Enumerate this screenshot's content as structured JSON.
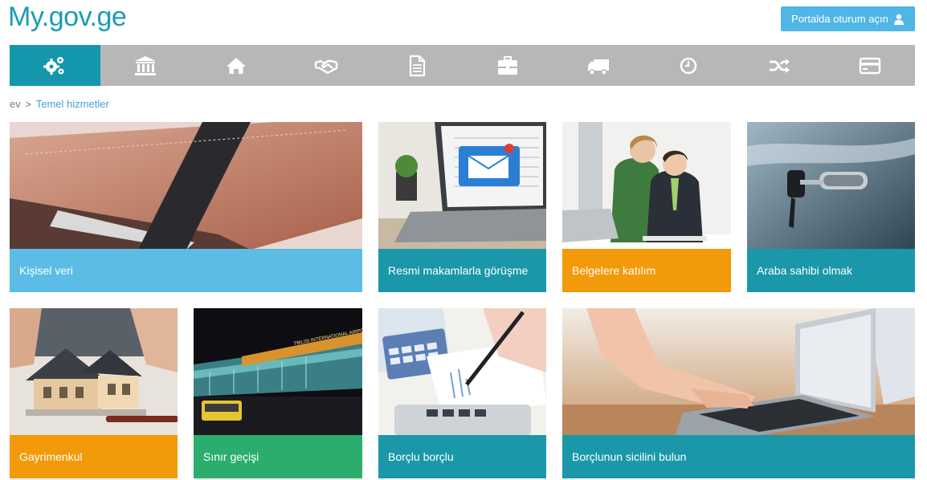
{
  "header": {
    "logo": "My.gov.ge",
    "login_label": "Portalda oturum açın"
  },
  "nav": {
    "items": [
      {
        "icon": "gears-icon",
        "active": true
      },
      {
        "icon": "institution-icon",
        "active": false
      },
      {
        "icon": "home-icon",
        "active": false
      },
      {
        "icon": "handshake-icon",
        "active": false
      },
      {
        "icon": "document-icon",
        "active": false
      },
      {
        "icon": "briefcase-icon",
        "active": false
      },
      {
        "icon": "truck-icon",
        "active": false
      },
      {
        "icon": "clock-icon",
        "active": false
      },
      {
        "icon": "shuffle-icon",
        "active": false
      },
      {
        "icon": "credit-card-icon",
        "active": false
      }
    ]
  },
  "breadcrumb": {
    "home": "ev",
    "separator": ">",
    "current": "Temel hizmetler"
  },
  "tiles": [
    {
      "label": "Kişisel veri",
      "color": "#5bbde6"
    },
    {
      "label": "Resmi makamlarla görüşme",
      "color": "#1a98a9"
    },
    {
      "label": "Belgelere katılım",
      "color": "#f29a0a"
    },
    {
      "label": "Araba sahibi olmak",
      "color": "#1a98a9"
    },
    {
      "label": "Gayrimenkul",
      "color": "#f29a0a"
    },
    {
      "label": "Sınır geçişi",
      "color": "#2bae6d"
    },
    {
      "label": "Borçlu borçlu",
      "color": "#1a98a9"
    },
    {
      "label": "Borçlunun sicilini bulun",
      "color": "#1a98a9"
    }
  ],
  "photo_content": {
    "airport_sign": "TBILISI INTERNATIONAL AIRPORT"
  }
}
